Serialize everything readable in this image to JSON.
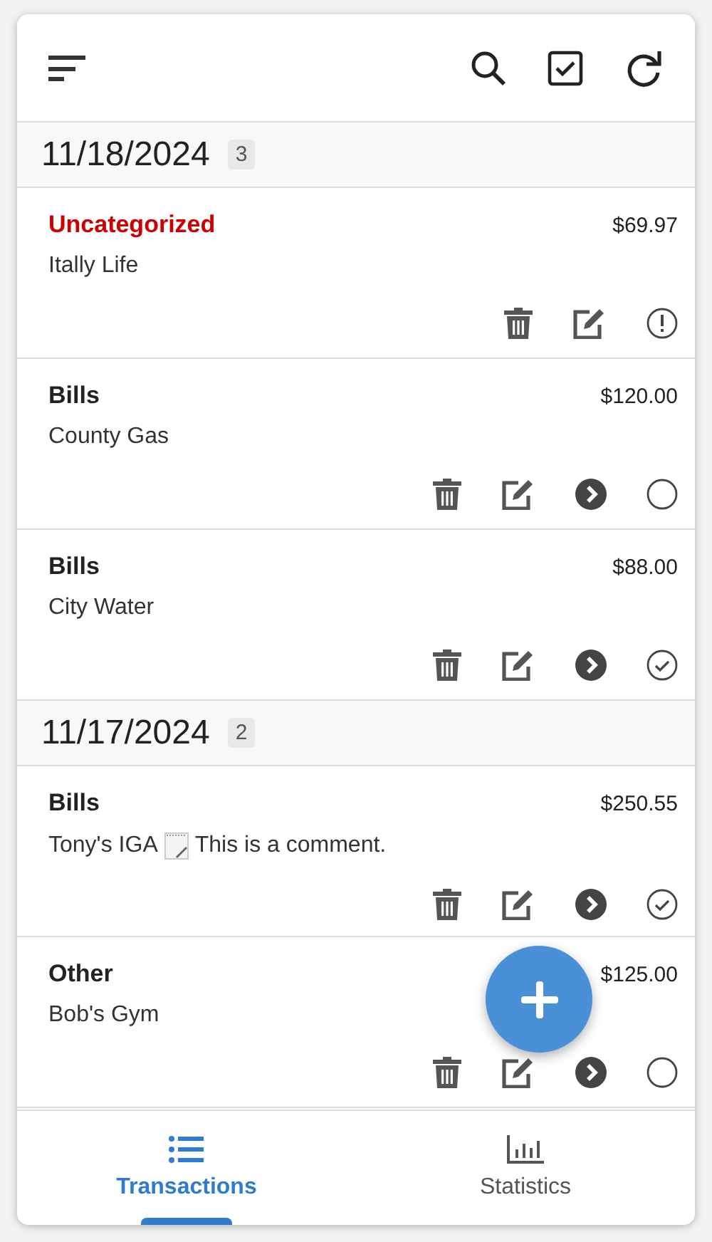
{
  "groups": [
    {
      "date": "11/18/2024",
      "count": "3",
      "transactions": [
        {
          "category": "Uncategorized",
          "uncategorized": true,
          "amount": "$69.97",
          "payee": "Itally Life",
          "kind": "flagged"
        },
        {
          "category": "Bills",
          "uncategorized": false,
          "amount": "$120.00",
          "payee": "County Gas",
          "kind": "open"
        },
        {
          "category": "Bills",
          "uncategorized": false,
          "amount": "$88.00",
          "payee": "City Water",
          "kind": "done"
        }
      ]
    },
    {
      "date": "11/17/2024",
      "count": "2",
      "transactions": [
        {
          "category": "Bills",
          "uncategorized": false,
          "amount": "$250.55",
          "payee": "Tony's IGA",
          "comment": "This is a comment.",
          "kind": "done"
        },
        {
          "category": "Other",
          "uncategorized": false,
          "amount": "$125.00",
          "payee": "Bob's Gym",
          "kind": "open"
        }
      ]
    }
  ],
  "nav": [
    {
      "label": "Transactions",
      "kind": "list",
      "selected": true
    },
    {
      "label": "Statistics",
      "kind": "chart",
      "selected": false
    }
  ]
}
